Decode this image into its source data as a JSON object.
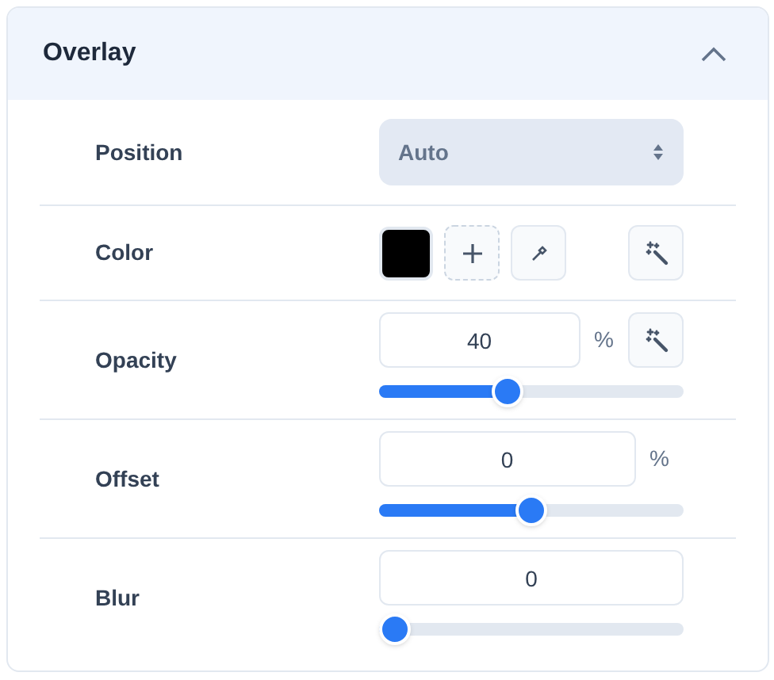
{
  "panel": {
    "title": "Overlay",
    "expanded": true
  },
  "rows": [
    {
      "kind": "select",
      "label": "Position",
      "value": "Auto"
    },
    {
      "kind": "color",
      "label": "Color",
      "color": "#000000"
    },
    {
      "kind": "number",
      "label": "Opacity",
      "value": "40",
      "unit": "%",
      "magic": true,
      "level": 0.41
    },
    {
      "kind": "number",
      "label": "Offset",
      "value": "0",
      "unit": "%",
      "level": 0.5
    },
    {
      "kind": "number",
      "label": "Blur",
      "value": "0",
      "level": 0
    }
  ]
}
